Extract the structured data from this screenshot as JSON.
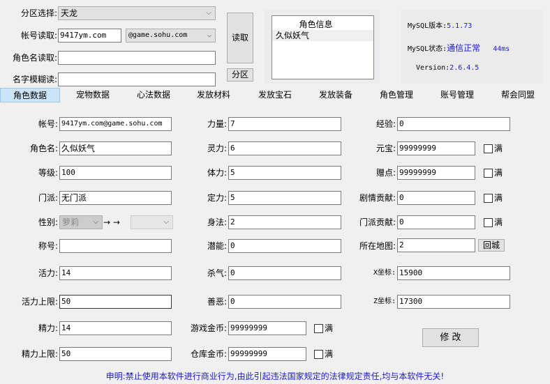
{
  "top": {
    "zone_label": "分区选择:",
    "zone_value": "天龙",
    "account_label": "帐号读取:",
    "account_value": "9417ym.com",
    "domain_value": "@game.sohu.com",
    "rolename_label": "角色名读取:",
    "rolename_value": "",
    "fuzzy_label": "名字模糊读:",
    "fuzzy_value": "",
    "read_button": "读取",
    "zone_button": "分区"
  },
  "role_list": {
    "header": "角色信息",
    "items": [
      "久似妖气"
    ]
  },
  "mysql": {
    "version_label": "MySQL版本:",
    "version": "5.1.73",
    "status_label": "MySQL状态:",
    "status": "通信正常",
    "latency": "44ms",
    "app_version_label": "Version:",
    "app_version": "2.6.4.5"
  },
  "tabs": [
    "角色数据",
    "宠物数据",
    "心法数据",
    "发放材料",
    "发放宝石",
    "发放装备",
    "角色管理",
    "账号管理",
    "帮会同盟"
  ],
  "form": {
    "account": {
      "label": "帐号:",
      "value": "9417ym.com@game.sohu.com"
    },
    "rolename": {
      "label": "角色名:",
      "value": "久似妖气"
    },
    "level": {
      "label": "等级:",
      "value": "100"
    },
    "school": {
      "label": "门派:",
      "value": "无门派"
    },
    "gender": {
      "label": "性别:",
      "value": "萝莉",
      "arrow": "→ →",
      "target": ""
    },
    "title": {
      "label": "称号:",
      "value": ""
    },
    "vitality": {
      "label": "活力:",
      "value": "14"
    },
    "vitality_max": {
      "label": "活力上限:",
      "value": "50"
    },
    "energy": {
      "label": "精力:",
      "value": "14"
    },
    "energy_max": {
      "label": "精力上限:",
      "value": "50"
    },
    "strength": {
      "label": "力量:",
      "value": "7"
    },
    "spirit": {
      "label": "灵力:",
      "value": "6"
    },
    "stamina": {
      "label": "体力:",
      "value": "5"
    },
    "focus": {
      "label": "定力:",
      "value": "5"
    },
    "agility": {
      "label": "身法:",
      "value": "2"
    },
    "potential": {
      "label": "潜能:",
      "value": "0"
    },
    "killing": {
      "label": "杀气:",
      "value": "0"
    },
    "morality": {
      "label": "善恶:",
      "value": "0"
    },
    "game_gold": {
      "label": "游戏金币:",
      "value": "99999999",
      "full": "满"
    },
    "bank_gold": {
      "label": "仓库金币:",
      "value": "99999999",
      "full": "满"
    },
    "exp": {
      "label": "经验:",
      "value": "0"
    },
    "yuanbao": {
      "label": "元宝:",
      "value": "99999999",
      "full": "满"
    },
    "zengdian": {
      "label": "赠点:",
      "value": "99999999",
      "full": "满"
    },
    "story": {
      "label": "剧情贡献:",
      "value": "0",
      "full": "满"
    },
    "school_contrib": {
      "label": "门派贡献:",
      "value": "0",
      "full": "满"
    },
    "map": {
      "label": "所在地图:",
      "value": "2",
      "return_button": "回城"
    },
    "x": {
      "label": "X坐标:",
      "value": "15900"
    },
    "z": {
      "label": "Z坐标:",
      "value": "17300"
    },
    "modify_button": "修 改"
  },
  "footer": "申明:禁止使用本软件进行商业行为,由此引起违法国家规定的法律规定责任,均与本软件无关!"
}
